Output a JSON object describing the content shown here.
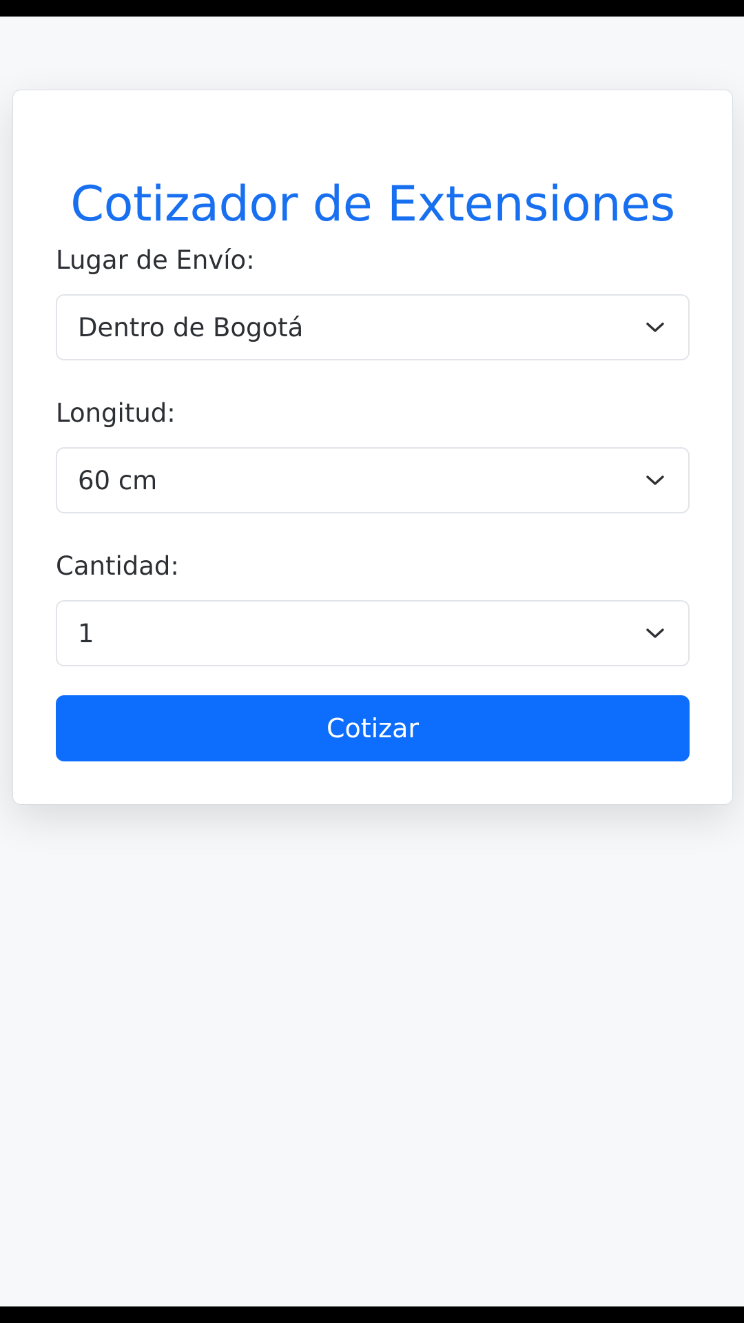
{
  "form": {
    "title": "Cotizador de Extensiones",
    "fields": [
      {
        "label": "Lugar de Envío:",
        "value": "Dentro de Bogotá",
        "icon": "chevron-down-icon"
      },
      {
        "label": "Longitud:",
        "value": "60 cm",
        "icon": "chevron-down-icon"
      },
      {
        "label": "Cantidad:",
        "value": "1",
        "icon": "chevron-down-icon"
      }
    ],
    "submit_label": "Cotizar"
  },
  "colors": {
    "accent": "#0d6efd",
    "title": "#1870f0",
    "background": "#f7f8fa",
    "text": "#2c2f33"
  }
}
